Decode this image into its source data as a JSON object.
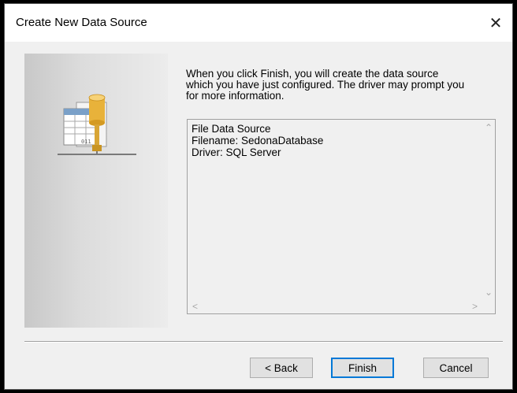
{
  "window": {
    "title": "Create New Data Source",
    "close_glyph": "✕"
  },
  "intro_text": "When you click Finish, you will create the data source\nwhich you have just configured.  The driver may prompt you\nfor more information.",
  "summary": {
    "lines": [
      "File Data Source",
      "Filename:  SedonaDatabase",
      "Driver:  SQL Server"
    ]
  },
  "buttons": {
    "back": "< Back",
    "finish": "Finish",
    "cancel": "Cancel"
  },
  "icons": {
    "side_panel": "database-network-icon",
    "close": "close-icon"
  },
  "colors": {
    "accent": "#0078d7",
    "dialog_bg": "#f0f0f0"
  }
}
